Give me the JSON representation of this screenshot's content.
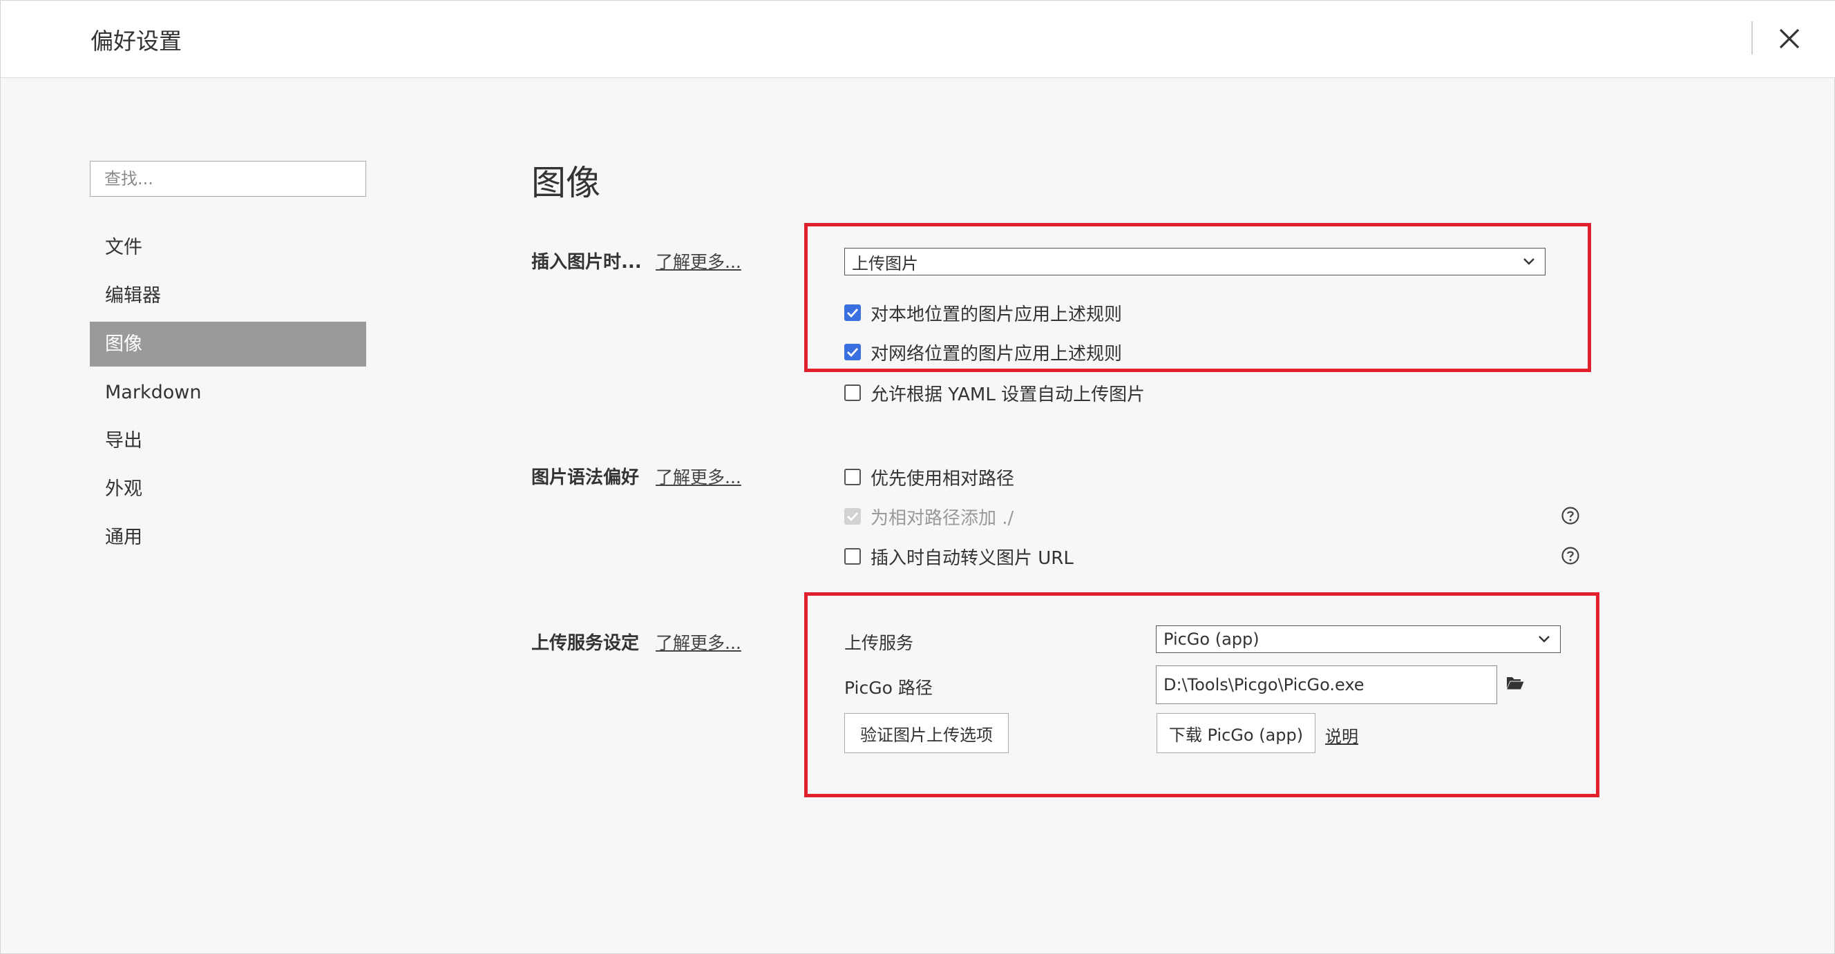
{
  "window": {
    "title": "偏好设置",
    "close_icon": "close-icon"
  },
  "sidebar": {
    "search_placeholder": "查找...",
    "items": [
      {
        "label": "文件",
        "active": false
      },
      {
        "label": "编辑器",
        "active": false
      },
      {
        "label": "图像",
        "active": true
      },
      {
        "label": "Markdown",
        "active": false
      },
      {
        "label": "导出",
        "active": false
      },
      {
        "label": "外观",
        "active": false
      },
      {
        "label": "通用",
        "active": false
      }
    ]
  },
  "main": {
    "title": "图像",
    "insert_section": {
      "label": "插入图片时...",
      "learn_more": "了解更多...",
      "action_value": "上传图片",
      "options": [
        {
          "label": "对本地位置的图片应用上述规则",
          "checked": true,
          "disabled": false
        },
        {
          "label": "对网络位置的图片应用上述规则",
          "checked": true,
          "disabled": false
        },
        {
          "label": "允许根据 YAML 设置自动上传图片",
          "checked": false,
          "disabled": false
        }
      ]
    },
    "syntax_section": {
      "label": "图片语法偏好",
      "learn_more": "了解更多...",
      "options": [
        {
          "label": "优先使用相对路径",
          "checked": false,
          "disabled": false
        },
        {
          "label": "为相对路径添加 ./",
          "checked": true,
          "disabled": true
        },
        {
          "label": "插入时自动转义图片 URL",
          "checked": false,
          "disabled": false
        }
      ]
    },
    "upload_section": {
      "label": "上传服务设定",
      "learn_more": "了解更多...",
      "service_label": "上传服务",
      "service_value": "PicGo (app)",
      "path_label": "PicGo 路径",
      "path_value": "D:\\Tools\\Picgo\\PicGo.exe",
      "verify_button": "验证图片上传选项",
      "download_button": "下载 PicGo (app)",
      "docs_link": "说明"
    }
  },
  "colors": {
    "accent_checkbox": "#3b6fe0",
    "highlight_box": "#e0202c",
    "active_nav": "#9a9a9a"
  }
}
